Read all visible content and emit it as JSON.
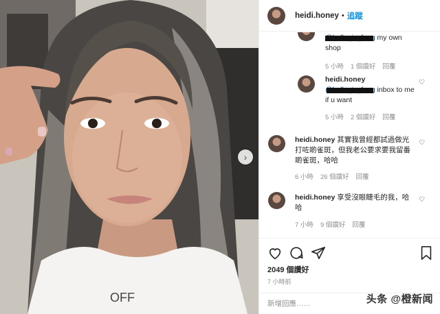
{
  "post": {
    "username": "heidi.honey",
    "follow_label": "追蹤",
    "likes_label": "2049 個讚好",
    "time_ago": "7 小時前",
    "add_comment_placeholder": "新增回應……",
    "shirt_text": "OFF"
  },
  "comments": [
    {
      "text": "my own shop",
      "mention": "@bella_is_fong",
      "meta": {
        "time": "5 小時",
        "likes": "1 個讚好",
        "reply": "回覆"
      }
    },
    {
      "name": "heidi.honey",
      "mention": "@bella_is_fong",
      "text": "inbox to me if u want",
      "meta": {
        "time": "5 小時",
        "likes": "2 個讚好",
        "reply": "回覆"
      }
    },
    {
      "name": "heidi.honey",
      "text": "其實我曾經都試過做光打咗啲雀斑，但我老公要求要我留番啲雀斑，哈哈",
      "meta": {
        "time": "6 小時",
        "likes": "26 個讚好",
        "reply": "回覆"
      }
    },
    {
      "name": "heidi.honey",
      "text": "享受沒眼睫毛的我，哈哈",
      "meta": {
        "time": "7 小時",
        "likes": "9 個讚好",
        "reply": "回覆"
      }
    }
  ],
  "watermark": "头条 @橙新闻",
  "icons": {
    "like": "heart-icon",
    "comment": "comment-bubble-icon",
    "share": "paper-plane-icon",
    "save": "bookmark-icon",
    "next": "chevron-right-icon"
  }
}
